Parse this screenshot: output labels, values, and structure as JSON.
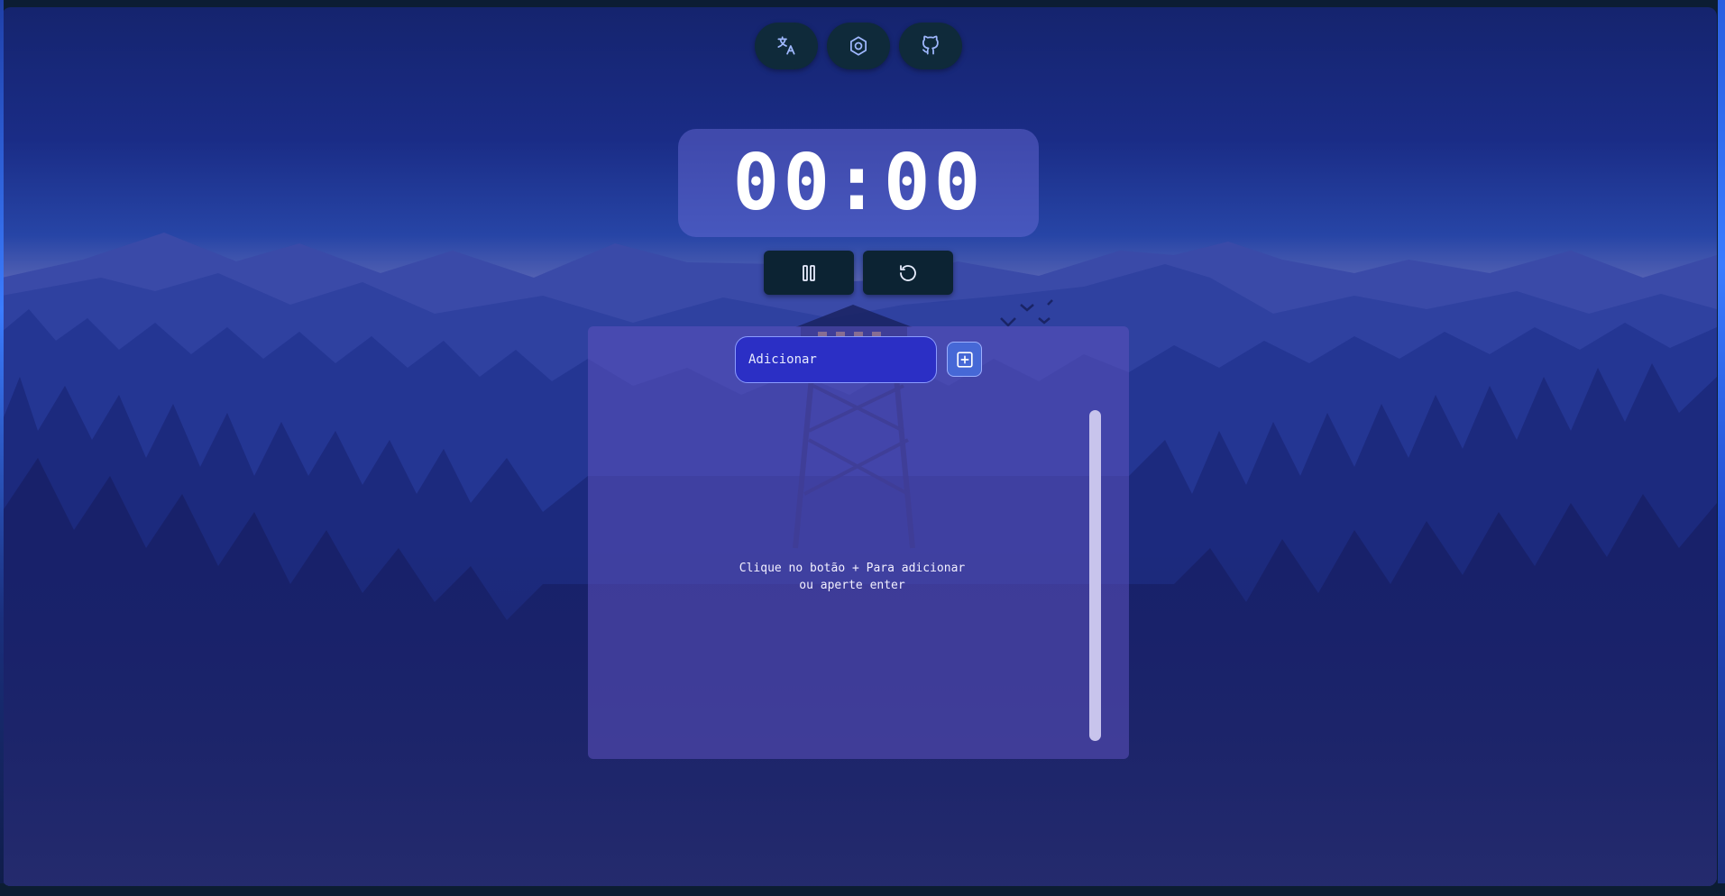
{
  "toolbar": {
    "buttons": [
      {
        "icon": "translate-icon",
        "label": ""
      },
      {
        "icon": "settings-icon",
        "label": ""
      },
      {
        "icon": "github-icon",
        "label": ""
      }
    ]
  },
  "timer": {
    "display": "00:00",
    "pause_icon": "pause-icon",
    "reset_icon": "reset-icon"
  },
  "tasks": {
    "input_placeholder": "Adicionar",
    "input_value": "",
    "add_icon": "plus-square-icon",
    "empty_line1": "Clique no botão + Para adicionar",
    "empty_line2": "ou aperte enter"
  },
  "colors": {
    "background": "#0c1d33",
    "button_dark": "#0f2a3a",
    "timer_panel": "#6e6edc",
    "accent_blue": "#4668d6",
    "task_panel": "#5c52be"
  }
}
